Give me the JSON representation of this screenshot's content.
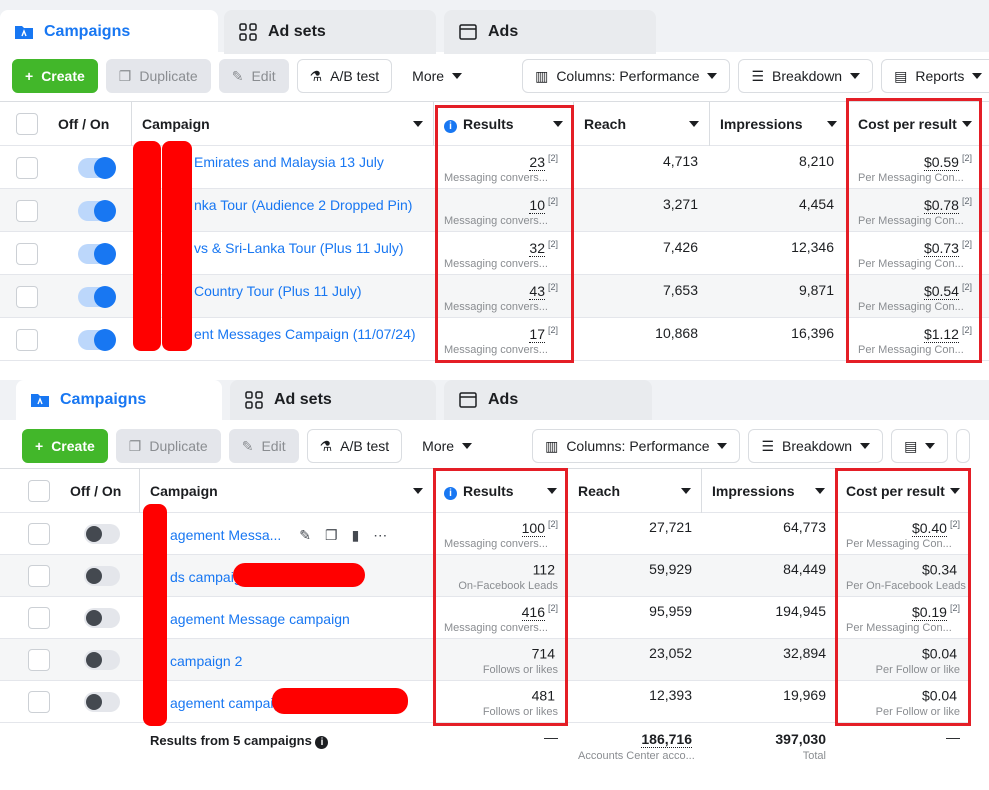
{
  "tabs": [
    {
      "label": "Campaigns",
      "icon": "folder-icon"
    },
    {
      "label": "Ad sets",
      "icon": "grid-icon"
    },
    {
      "label": "Ads",
      "icon": "ad-icon"
    }
  ],
  "toolbar": {
    "create": "Create",
    "duplicate": "Duplicate",
    "edit": "Edit",
    "ab_test": "A/B test",
    "more": "More",
    "columns": "Columns: Performance",
    "breakdown": "Breakdown",
    "reports": "Reports"
  },
  "columns": {
    "off_on": "Off / On",
    "campaign": "Campaign",
    "results": "Results",
    "reach": "Reach",
    "impressions": "Impressions",
    "cost_per_result": "Cost per result"
  },
  "table1": [
    {
      "name": "Emirates and Malaysia 13 July",
      "on": true,
      "results": "23",
      "results_sub": "Messaging convers...",
      "reach": "4,713",
      "impressions": "8,210",
      "cost": "$0.59",
      "cost_sub": "Per Messaging Con..."
    },
    {
      "name": "nka Tour (Audience 2 Dropped Pin)",
      "on": true,
      "results": "10",
      "results_sub": "Messaging convers...",
      "reach": "3,271",
      "impressions": "4,454",
      "cost": "$0.78",
      "cost_sub": "Per Messaging Con..."
    },
    {
      "name": "vs & Sri-Lanka Tour (Plus 11 July)",
      "on": true,
      "results": "32",
      "results_sub": "Messaging convers...",
      "reach": "7,426",
      "impressions": "12,346",
      "cost": "$0.73",
      "cost_sub": "Per Messaging Con..."
    },
    {
      "name": "Country Tour (Plus 11 July)",
      "on": true,
      "results": "43",
      "results_sub": "Messaging convers...",
      "reach": "7,653",
      "impressions": "9,871",
      "cost": "$0.54",
      "cost_sub": "Per Messaging Con..."
    },
    {
      "name": "ent Messages Campaign (11/07/24)",
      "on": true,
      "results": "17",
      "results_sub": "Messaging convers...",
      "reach": "10,868",
      "impressions": "16,396",
      "cost": "$1.12",
      "cost_sub": "Per Messaging Con..."
    }
  ],
  "table2": [
    {
      "name": "agement Messa...",
      "on": false,
      "results": "100",
      "results_sup": "[2]",
      "results_sub": "Messaging convers...",
      "reach": "27,721",
      "impressions": "64,773",
      "cost": "$0.40",
      "cost_sup": "[2]",
      "cost_sub": "Per Messaging Con..."
    },
    {
      "name": "ds campaign",
      "on": false,
      "results": "112",
      "results_sup": "",
      "results_sub": "On-Facebook Leads",
      "reach": "59,929",
      "impressions": "84,449",
      "cost": "$0.34",
      "cost_sup": "",
      "cost_sub": "Per On-Facebook Leads"
    },
    {
      "name": "agement Message campaign",
      "on": false,
      "results": "416",
      "results_sup": "[2]",
      "results_sub": "Messaging convers...",
      "reach": "95,959",
      "impressions": "194,945",
      "cost": "$0.19",
      "cost_sup": "[2]",
      "cost_sub": "Per Messaging Con..."
    },
    {
      "name": "campaign 2",
      "on": false,
      "results": "714",
      "results_sup": "",
      "results_sub": "Follows or likes",
      "reach": "23,052",
      "impressions": "32,894",
      "cost": "$0.04",
      "cost_sup": "",
      "cost_sub": "Per Follow or like"
    },
    {
      "name": "agement campaign",
      "on": false,
      "results": "481",
      "results_sup": "",
      "results_sub": "Follows or likes",
      "reach": "12,393",
      "impressions": "19,969",
      "cost": "$0.04",
      "cost_sup": "",
      "cost_sub": "Per Follow or like"
    }
  ],
  "sup_marker": "[2]",
  "summary": {
    "label": "Results from 5 campaigns",
    "results": "—",
    "reach": "186,716",
    "reach_sub": "Accounts Center acco...",
    "impressions": "397,030",
    "impressions_sub": "Total",
    "cost": "—"
  },
  "colors": {
    "accent": "#1877f2",
    "create": "#42b72a",
    "highlight": "#e41e26",
    "redaction": "#ff0000"
  }
}
